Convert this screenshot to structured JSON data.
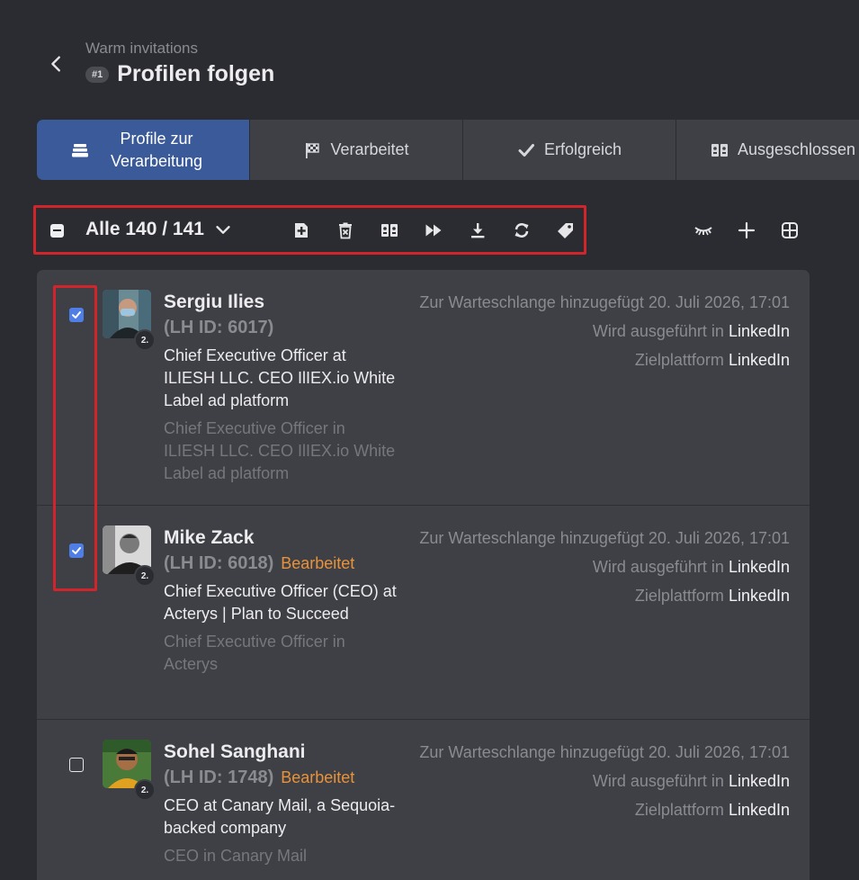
{
  "header": {
    "subtitle": "Warm invitations",
    "step_badge": "#1",
    "title": "Profilen folgen"
  },
  "tabs": [
    {
      "label": "Profile zur Verarbeitung",
      "icon": "queue-stack-icon",
      "active": true
    },
    {
      "label": "Verarbeitet",
      "icon": "checkered-flag-icon",
      "active": false
    },
    {
      "label": "Erfolgreich",
      "icon": "checkmark-icon",
      "active": false
    },
    {
      "label": "Ausgeschlossen",
      "icon": "excluded-people-icon",
      "active": false
    }
  ],
  "toolbar": {
    "count_label": "Alle 140 / 141",
    "icons": [
      "add-icon",
      "delete-icon",
      "exclude-icon",
      "skip-forward-icon",
      "download-icon",
      "refresh-icon",
      "tag-icon"
    ]
  },
  "right_tools": [
    "hide-icon",
    "plus-icon",
    "grid-icon"
  ],
  "colors": {
    "background": "#2b2c31",
    "panel": "#3f4046",
    "active_tab": "#3b5a9a",
    "checkbox": "#4f7fe6",
    "edited": "#e8923a",
    "highlight_frame": "#d1242b"
  },
  "profiles": [
    {
      "name": "Sergiu Ilies",
      "lh_id": "(LH ID: 6017)",
      "edited": "",
      "degree": "2.",
      "headline": "Chief Executive Officer at ILIESH LLC. CEO IlIEX.io White Label ad platform",
      "job": "Chief Executive Officer in ILIESH LLC. CEO IlIEX.io White Label ad platform",
      "queued_label": "Zur Warteschlange hinzugefügt 20. Juli 2026, 17:01",
      "executed_label": "Wird ausgeführt in",
      "executed_value": "LinkedIn",
      "target_label": "Zielplattform",
      "target_value": "LinkedIn",
      "checked": true
    },
    {
      "name": "Mike Zack",
      "lh_id": "(LH ID: 6018)",
      "edited": "Bearbeitet",
      "degree": "2.",
      "headline": "Chief Executive Officer (CEO) at Acterys | Plan to Succeed",
      "job": "Chief Executive Officer in Acterys",
      "queued_label": "Zur Warteschlange hinzugefügt 20. Juli 2026, 17:01",
      "executed_label": "Wird ausgeführt in",
      "executed_value": "LinkedIn",
      "target_label": "Zielplattform",
      "target_value": "LinkedIn",
      "checked": true
    },
    {
      "name": "Sohel Sanghani",
      "lh_id": "(LH ID: 1748)",
      "edited": "Bearbeitet",
      "degree": "2.",
      "headline": "CEO at Canary Mail, a Sequoia-backed company",
      "job": "CEO in Canary Mail",
      "queued_label": "Zur Warteschlange hinzugefügt 20. Juli 2026, 17:01",
      "executed_label": "Wird ausgeführt in",
      "executed_value": "LinkedIn",
      "target_label": "Zielplattform",
      "target_value": "LinkedIn",
      "checked": false
    }
  ]
}
